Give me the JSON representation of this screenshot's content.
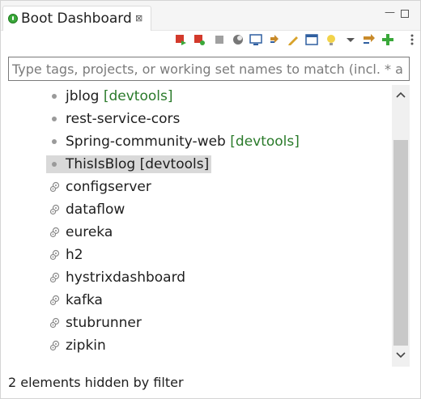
{
  "view": {
    "title": "Boot Dashboard",
    "close_symbol": "⊠",
    "minimize_symbol": "—"
  },
  "toolbar": {
    "buttons": [
      {
        "name": "start-icon",
        "color": "#d33a2c"
      },
      {
        "name": "debug-icon",
        "color": "#d33a2c"
      },
      {
        "name": "stop-icon",
        "color": "#a0a0a0"
      },
      {
        "name": "refresh-icon",
        "color": "#777777"
      },
      {
        "name": "console-icon",
        "color": "#2f5fa0"
      },
      {
        "name": "link-icon",
        "color": "#c88a2a"
      },
      {
        "name": "edit-icon",
        "color": "#d8a22b"
      },
      {
        "name": "properties-icon",
        "color": "#2f5fa0"
      },
      {
        "name": "lightbulb-icon",
        "color": "#f2d34a"
      },
      {
        "name": "menu-dropdown-icon",
        "color": "#555555"
      },
      {
        "name": "filter-icon",
        "color": "#c88a2a"
      },
      {
        "name": "add-icon",
        "color": "#3aa83a"
      },
      {
        "name": "more-icon",
        "color": "#555555"
      }
    ]
  },
  "filter": {
    "placeholder": "Type tags, projects, or working set names to match (incl. * a"
  },
  "tree": {
    "items": [
      {
        "name": "jblog",
        "tag": "[devtools]",
        "kind": "dot"
      },
      {
        "name": "rest-service-cors",
        "tag": "",
        "kind": "dot"
      },
      {
        "name": "Spring-community-web",
        "tag": "[devtools]",
        "kind": "dot"
      },
      {
        "name": "ThisIsBlog [devtools]",
        "tag": "",
        "kind": "dot",
        "selected": true
      },
      {
        "name": "configserver",
        "tag": "",
        "kind": "gear"
      },
      {
        "name": "dataflow",
        "tag": "",
        "kind": "gear"
      },
      {
        "name": "eureka",
        "tag": "",
        "kind": "gear"
      },
      {
        "name": "h2",
        "tag": "",
        "kind": "gear"
      },
      {
        "name": "hystrixdashboard",
        "tag": "",
        "kind": "gear"
      },
      {
        "name": "kafka",
        "tag": "",
        "kind": "gear"
      },
      {
        "name": "stubrunner",
        "tag": "",
        "kind": "gear"
      },
      {
        "name": "zipkin",
        "tag": "",
        "kind": "gear"
      }
    ]
  },
  "status": {
    "text": "2 elements hidden by filter"
  }
}
